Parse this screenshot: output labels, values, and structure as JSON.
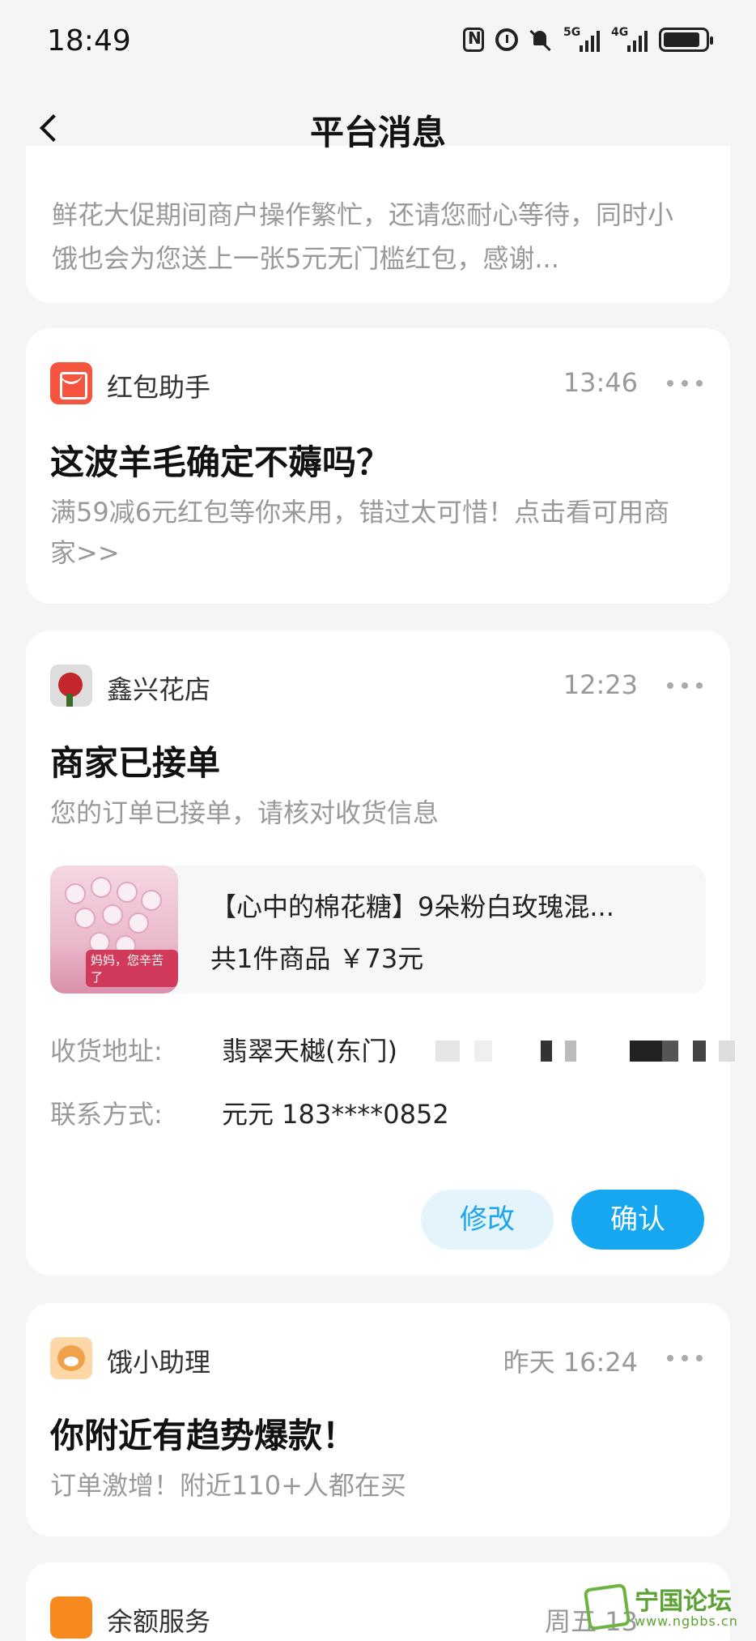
{
  "status_bar": {
    "time": "18:49",
    "net_5g": "5G",
    "net_4g": "4G"
  },
  "nav": {
    "title": "平台消息"
  },
  "messages": [
    {
      "body": "鲜花大促期间商户操作繁忙，还请您耐心等待，同时小饿也会为您送上一张5元无门槛红包，感谢..."
    },
    {
      "sender": "红包助手",
      "sender_icon": "red-packet-icon",
      "time": "13:46",
      "title": "这波羊毛确定不薅吗？",
      "body": "满59减6元红包等你来用，错过太可惜！点击看可用商家>>"
    },
    {
      "sender": "鑫兴花店",
      "sender_icon": "flower-shop-avatar",
      "time": "12:23",
      "title": "商家已接单",
      "body": "您的订单已接单，请核对收货信息",
      "product": {
        "name": "【心中的棉花糖】9朵粉白玫瑰混...",
        "summary": "共1件商品 ￥73元",
        "thumb_tag": "妈妈，您辛苦了"
      },
      "address_label": "收货地址:",
      "address_value": "翡翠天樾(东门)",
      "contact_label": "联系方式:",
      "contact_value": "元元 183****0852",
      "edit_button": "修改",
      "confirm_button": "确认"
    },
    {
      "sender": "饿小助理",
      "sender_icon": "assistant-avatar",
      "time": "昨天 16:24",
      "title": "你附近有趋势爆款！",
      "body": "订单激增！附近110+人都在买"
    },
    {
      "sender": "余额服务",
      "sender_icon": "balance-service-icon",
      "time": "周五 13"
    }
  ],
  "watermark": {
    "text": "宁国论坛",
    "url": "www.ngbbs.cn"
  },
  "colors": {
    "accent": "#16a7f0",
    "red_packet": "#f5553e",
    "background": "#f5f5f5",
    "watermark": "#5aa232"
  }
}
